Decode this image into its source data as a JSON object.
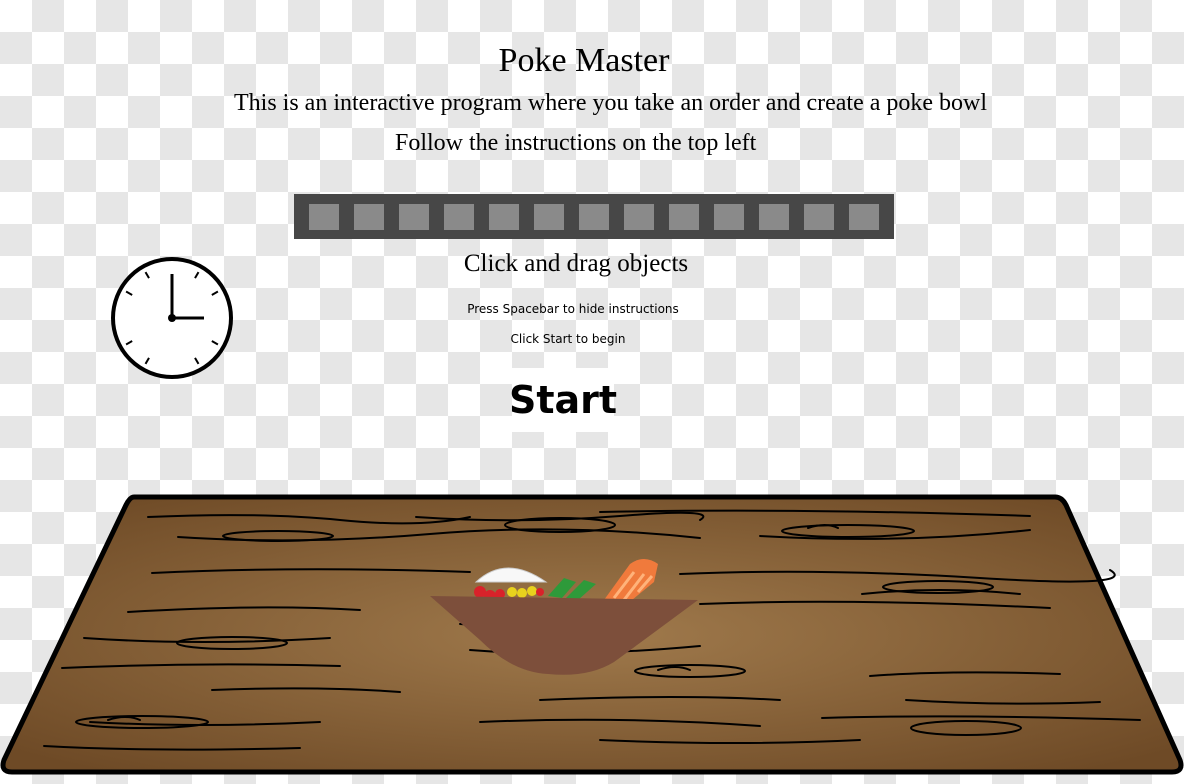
{
  "header": {
    "title": "Poke Master",
    "description": "This is an interactive program where you take an order and create a poke bowl",
    "hint": "Follow the instructions on the top left"
  },
  "progress": {
    "filled_segments": 0,
    "total_segments": 13
  },
  "instructions": {
    "drag": "Click and drag objects",
    "spacebar": "Press Spacebar to hide instructions",
    "begin": "Click Start to begin"
  },
  "start_label": "Start",
  "clock": {
    "hour": 3,
    "minute": 0,
    "icon": "clock-icon"
  },
  "scene": {
    "table": "wooden-table",
    "bowl": "poke-bowl-icon"
  },
  "colors": {
    "progress_bg": "#474747",
    "progress_segment": "#8a8a8a",
    "table": "#8a6238",
    "bowl": "#7d4f3b",
    "salmon": "#f07a3c"
  }
}
